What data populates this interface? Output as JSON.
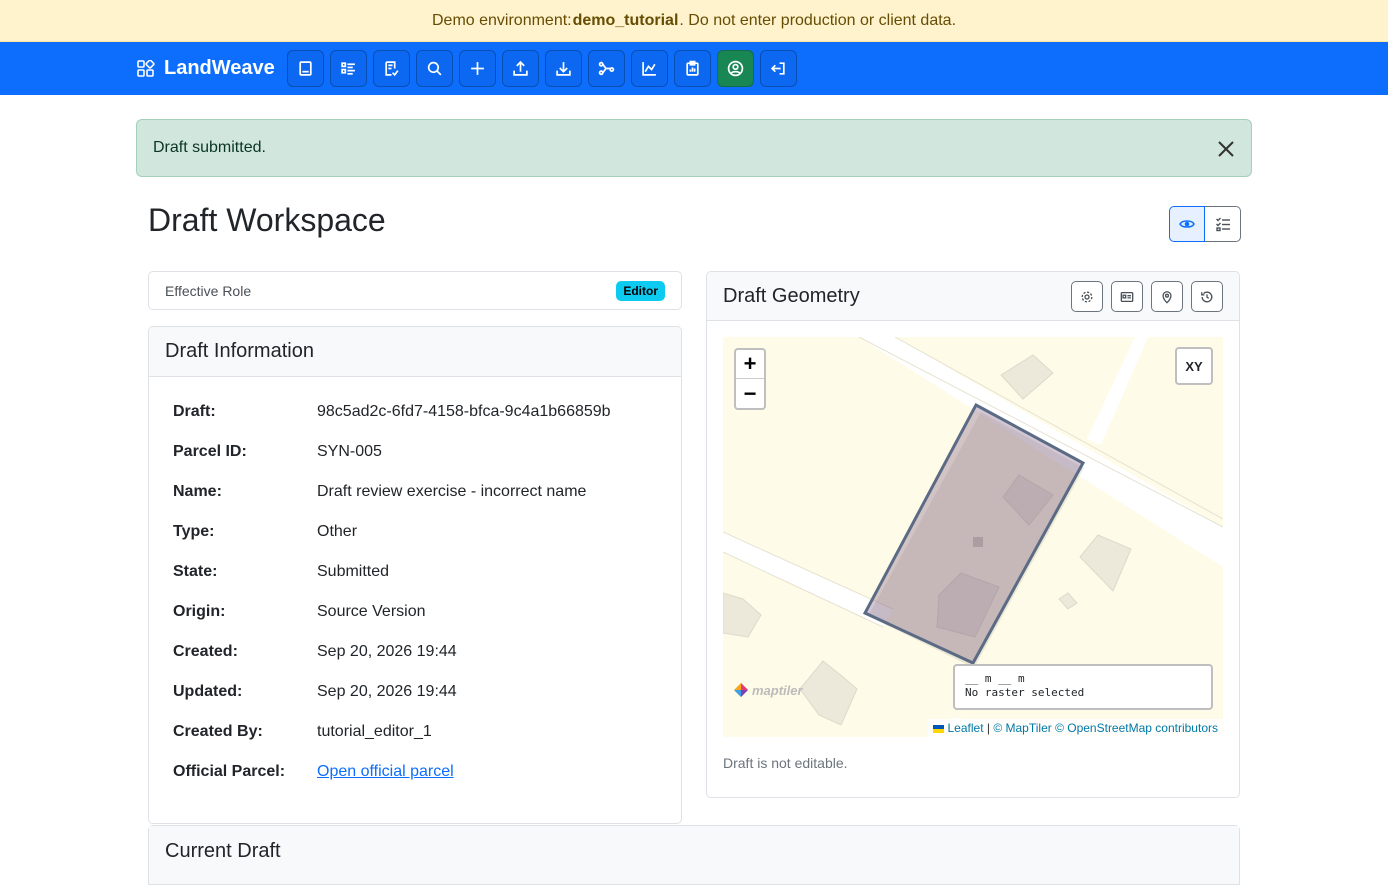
{
  "demo_banner": {
    "prefix": "Demo environment: ",
    "env_name": "demo_tutorial",
    "suffix": ". Do not enter production or client data."
  },
  "navbar": {
    "brand": "LandWeave",
    "buttons": [
      {
        "icon": "book-icon"
      },
      {
        "icon": "list-icon"
      },
      {
        "icon": "doc-check-icon"
      },
      {
        "icon": "search-icon"
      },
      {
        "icon": "plus-icon"
      },
      {
        "icon": "upload-icon"
      },
      {
        "icon": "download-icon"
      },
      {
        "icon": "share-nodes-icon"
      },
      {
        "icon": "chart-icon"
      },
      {
        "icon": "clipboard-icon"
      },
      {
        "icon": "user-circle-icon",
        "active": true
      },
      {
        "icon": "logout-icon"
      }
    ]
  },
  "alert": {
    "message": "Draft submitted."
  },
  "page": {
    "title": "Draft Workspace"
  },
  "role": {
    "label": "Effective Role",
    "badge": "Editor"
  },
  "info": {
    "title": "Draft Information",
    "rows": [
      {
        "label": "Draft:",
        "value": "98c5ad2c-6fd7-4158-bfca-9c4a1b66859b"
      },
      {
        "label": "Parcel ID:",
        "value": "SYN-005"
      },
      {
        "label": "Name:",
        "value": "Draft review exercise - incorrect name"
      },
      {
        "label": "Type:",
        "value": "Other"
      },
      {
        "label": "State:",
        "value": "Submitted"
      },
      {
        "label": "Origin:",
        "value": "Source Version"
      },
      {
        "label": "Created:",
        "value": "Sep 20, 2026 19:44"
      },
      {
        "label": "Updated:",
        "value": "Sep 20, 2026 19:44"
      },
      {
        "label": "Created By:",
        "value": "tutorial_editor_1"
      },
      {
        "label": "Official Parcel:",
        "value": "Open official parcel"
      }
    ]
  },
  "geometry": {
    "title": "Draft Geometry",
    "zoom_in": "+",
    "zoom_out": "−",
    "xy_label": "XY",
    "readout_line1": "__ m __ m",
    "readout_line2": "No raster selected",
    "maptiler": "maptiler",
    "attr_leaflet": "Leaflet",
    "attr_sep": " | ",
    "attr_rest": "© MapTiler © OpenStreetMap contributors",
    "note": "Draft is not editable."
  },
  "current_draft": {
    "title": "Current Draft"
  },
  "colors": {
    "navbar": "#0d6efd",
    "alert_bg": "#d1e7dd",
    "banner_bg": "#fff3cd",
    "badge": "#0dcaf0",
    "active_btn": "#198754"
  }
}
